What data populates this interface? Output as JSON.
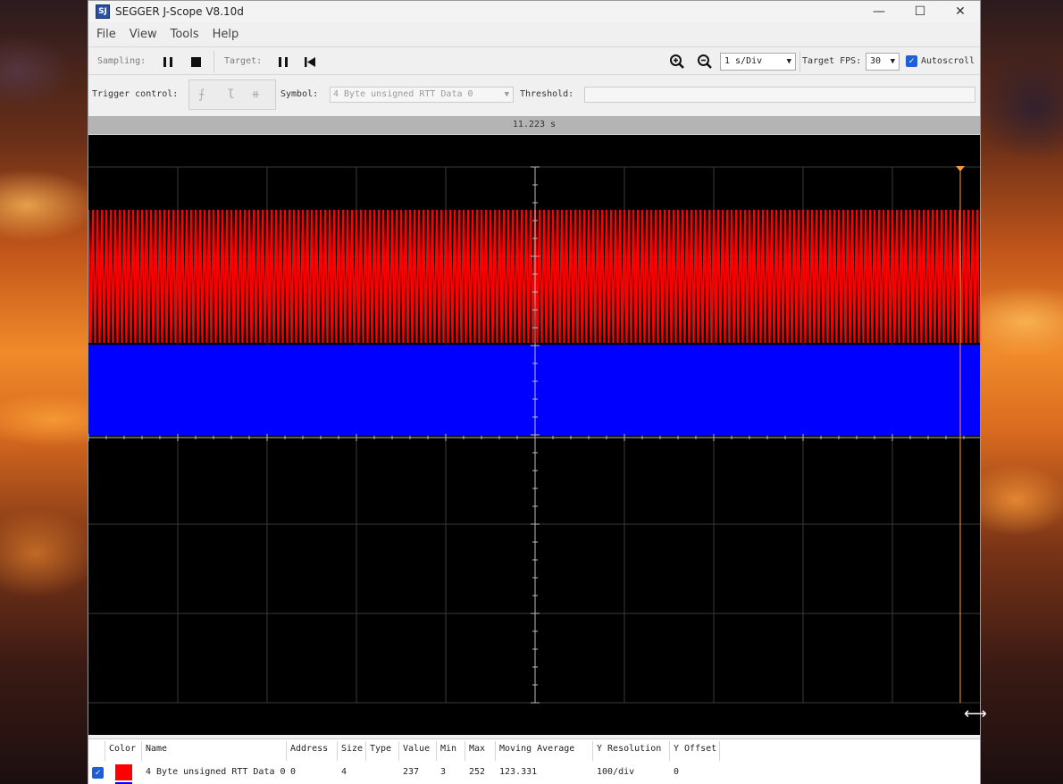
{
  "window": {
    "title": "SEGGER J-Scope V8.10d",
    "icon_text": "SJ",
    "controls": {
      "minimize": "—",
      "maximize": "☐",
      "close": "✕"
    }
  },
  "menu": [
    "File",
    "View",
    "Tools",
    "Help"
  ],
  "toolbar": {
    "sampling_label": "Sampling:",
    "target_label": "Target:",
    "timebase": "1 s/Div",
    "target_fps_label": "Target FPS:",
    "target_fps": "30",
    "autoscroll_label": "Autoscroll",
    "autoscroll_checked": true,
    "icons": [
      "pause-icon",
      "stop-icon",
      "pause-icon",
      "skip-to-start-icon",
      "zoom-in-icon",
      "zoom-out-icon"
    ]
  },
  "trigger": {
    "label": "Trigger control:",
    "symbol_label": "Symbol:",
    "symbol_value": "4 Byte unsigned RTT Data 0",
    "threshold_label": "Threshold:",
    "threshold_value": ""
  },
  "time_readout": "11.223 s",
  "colors": {
    "series_red": "#ff0000",
    "series_blue": "#0000ff",
    "cursor": "#ff9a3c",
    "grid": "#3a3a3a"
  },
  "table": {
    "headers": [
      "Color",
      "Name",
      "Address",
      "Size",
      "Type",
      "Value",
      "Min",
      "Max",
      "Moving Average",
      "Y Resolution",
      "Y Offset"
    ],
    "rows": [
      {
        "checked": true,
        "color": "#ff0000",
        "name": "4 Byte unsigned RTT Data 0",
        "address": "0",
        "size": "4",
        "type": "",
        "value": "237",
        "min": "3",
        "max": "252",
        "moving_average": "123.331",
        "y_resolution": "100/div",
        "y_offset": "0"
      }
    ]
  }
}
